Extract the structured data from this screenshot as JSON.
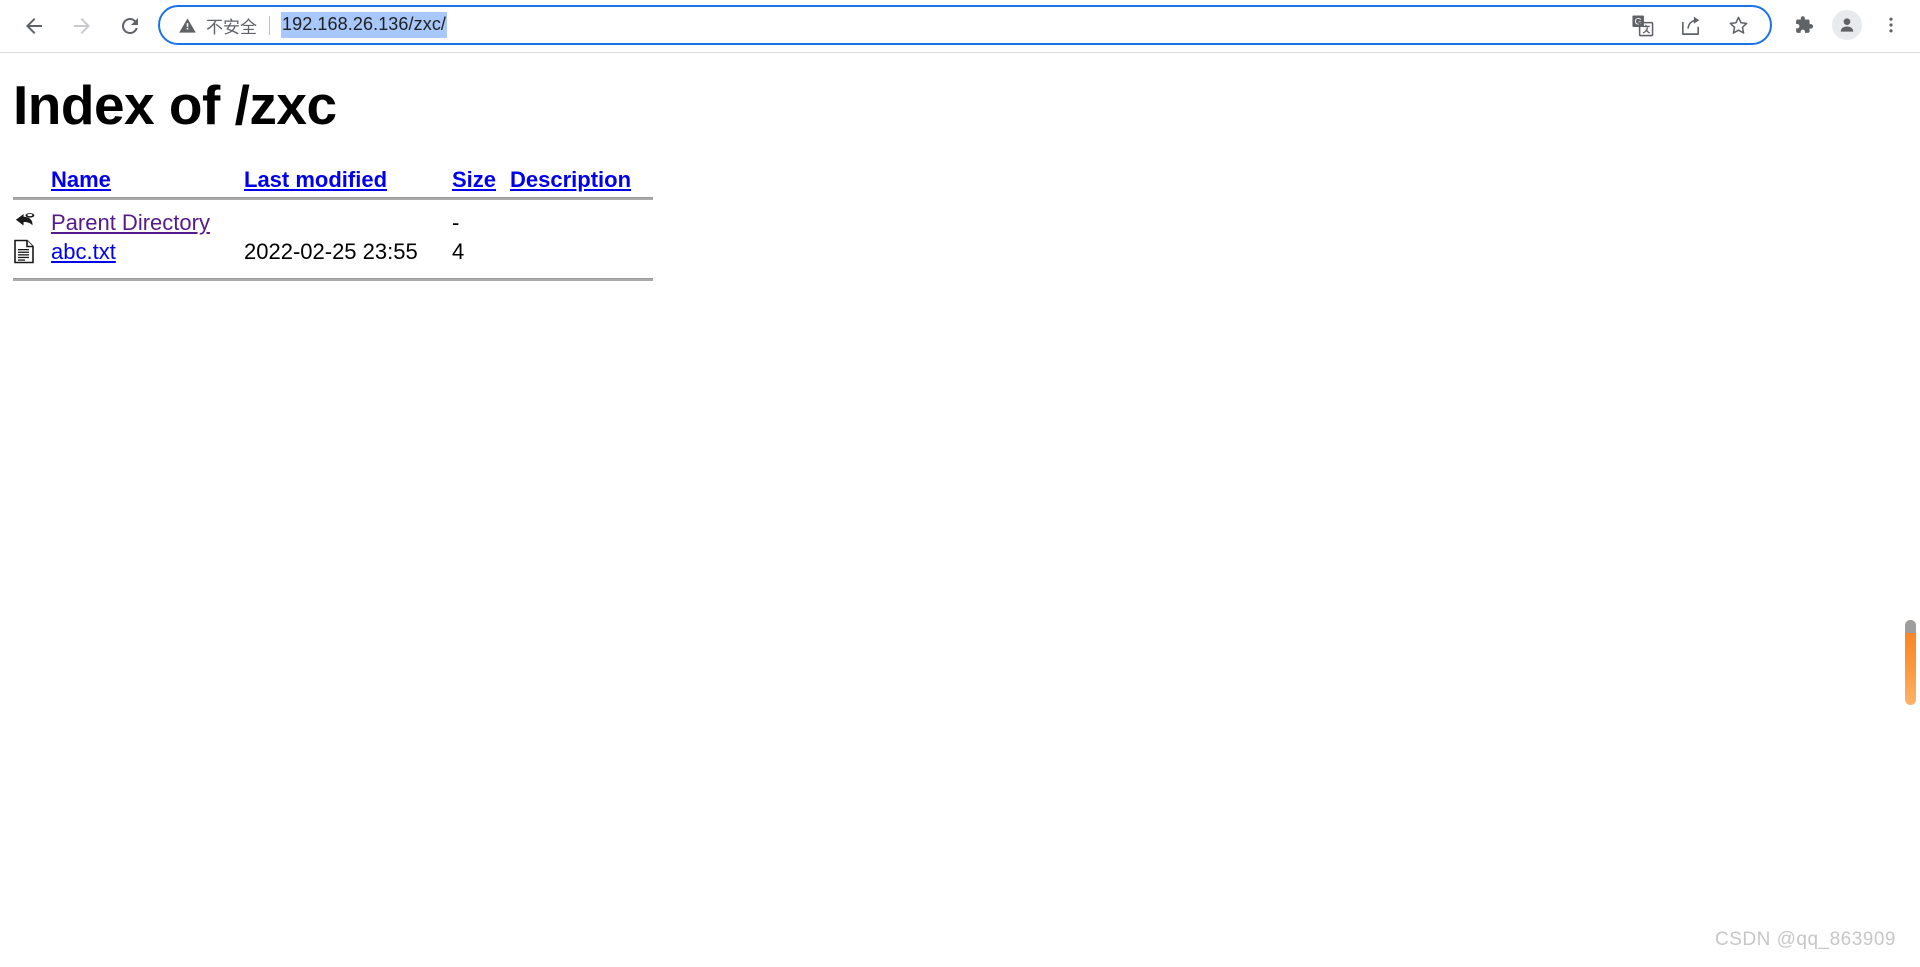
{
  "browser": {
    "nav": {
      "back_label": "Back",
      "forward_label": "Forward",
      "reload_label": "Reload"
    },
    "omnibox": {
      "security_text": "不安全",
      "security_icon": "warning-triangle-icon",
      "url": "192.168.26.136/zxc/",
      "url_selected": true,
      "selection_color": "#a8c7fa",
      "border_color": "#1a73e8",
      "actions": [
        {
          "name": "translate-icon",
          "label": "Translate this page"
        },
        {
          "name": "share-icon",
          "label": "Share this page"
        },
        {
          "name": "bookmark-star-icon",
          "label": "Bookmark this tab"
        }
      ]
    },
    "toolbar_right": [
      {
        "name": "extensions-puzzle-icon",
        "label": "Extensions"
      },
      {
        "name": "profile-avatar-icon",
        "label": "Profile"
      },
      {
        "name": "three-dot-menu-icon",
        "label": "Customize and control Google Chrome"
      }
    ]
  },
  "page": {
    "title": "Index of /zxc",
    "table": {
      "headers": [
        {
          "label": "Name",
          "key": "name"
        },
        {
          "label": "Last modified",
          "key": "last_modified"
        },
        {
          "label": "Size",
          "key": "size"
        },
        {
          "label": "Description",
          "key": "description"
        }
      ],
      "rows": [
        {
          "icon": "parent-directory-arrow-icon",
          "name": "Parent Directory",
          "last_modified": "",
          "size": "-",
          "description": "",
          "link_state": "visited"
        },
        {
          "icon": "text-file-icon",
          "name": "abc.txt",
          "last_modified": "2022-02-25 23:55",
          "size": "4",
          "description": "",
          "link_state": "unvisited"
        }
      ]
    },
    "link_color": "#0000ee",
    "visited_link_color": "#551a8b"
  },
  "scrollbar": {
    "thumb_color": "#f98020",
    "name": "vertical-scrollbar"
  },
  "watermark": {
    "text": "CSDN @qq_863909"
  }
}
